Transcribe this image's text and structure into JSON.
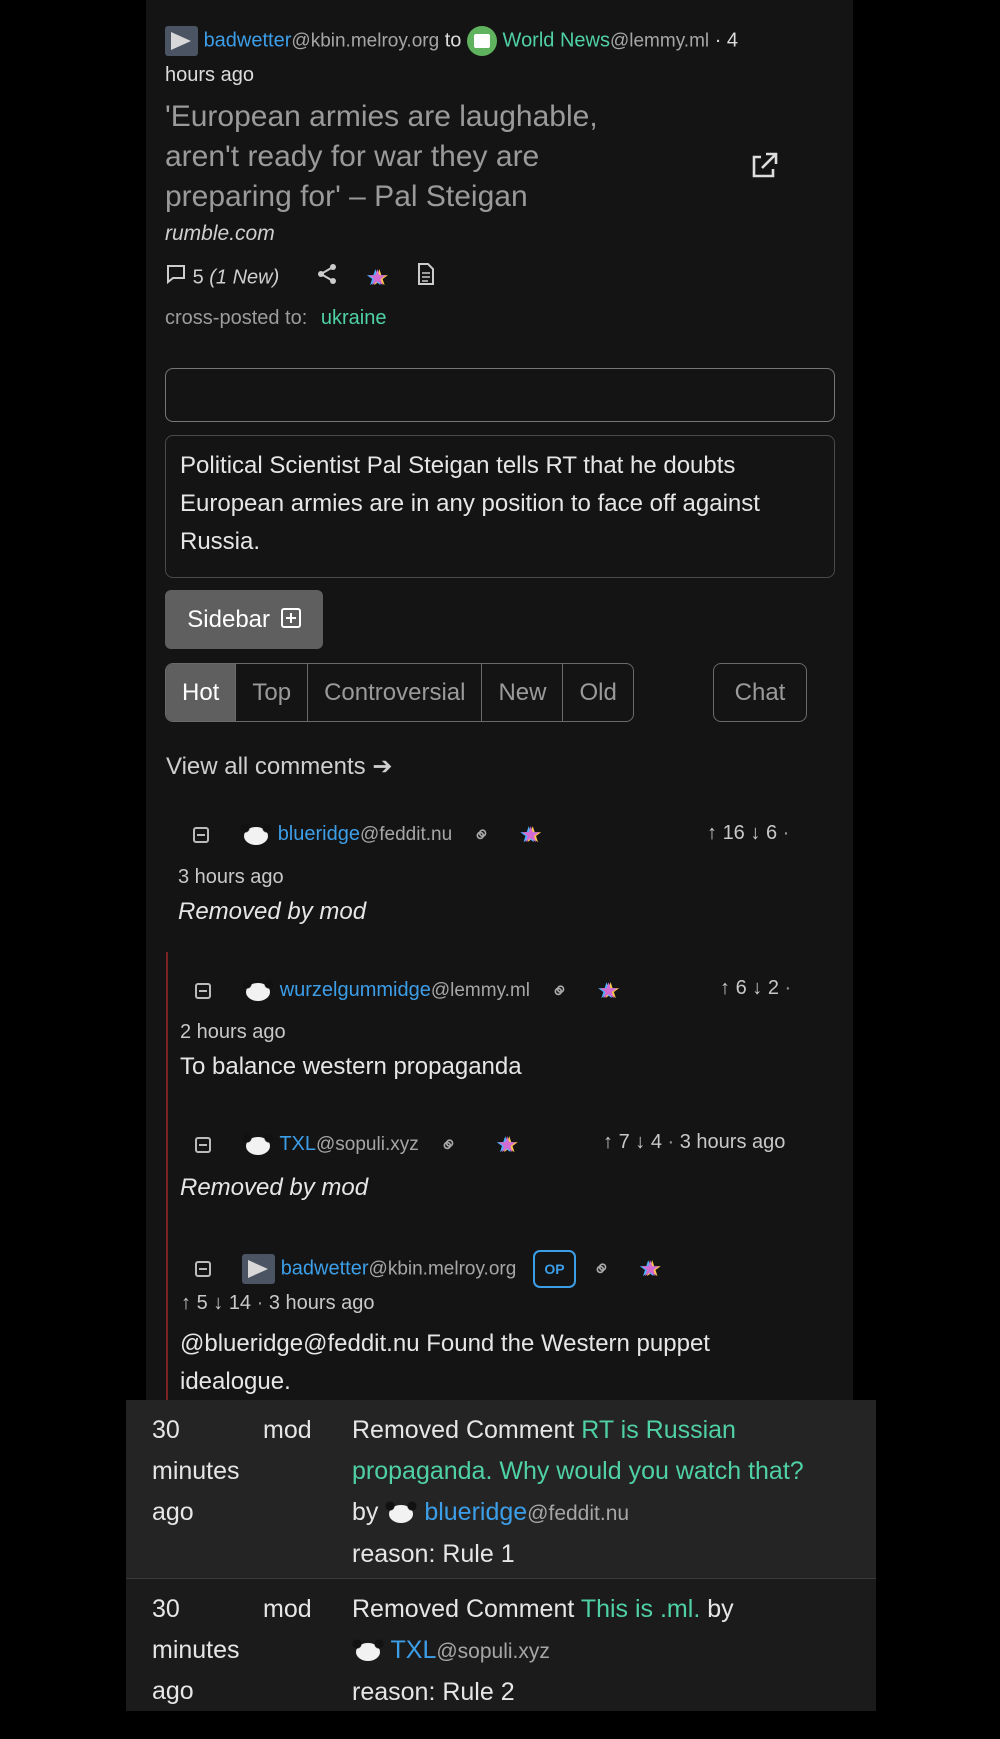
{
  "post": {
    "author_name": "badwetter",
    "author_instance": "@kbin.melroy.org",
    "to_word": "to",
    "community_name": "World News",
    "community_instance": "@lemmy.ml",
    "time_line1": "· 4",
    "time_line2": "hours ago",
    "title_lines": [
      "'European armies are laughable,",
      "aren't ready for war they are",
      "preparing for' – Pal Steigan"
    ],
    "domain": "rumble.com",
    "comment_count": "5",
    "comment_new": "(1 New)",
    "crosspost_label": "cross-posted to:",
    "crosspost_target": "ukraine",
    "body": "Political Scientist Pal Steigan tells RT that he doubts European armies are in any position to face off against Russia.",
    "sidebar_label": "Sidebar"
  },
  "sort_tabs": [
    "Hot",
    "Top",
    "Controversial",
    "New",
    "Old"
  ],
  "chat_label": "Chat",
  "view_all": "View all comments",
  "comments": [
    {
      "name": "blueridge",
      "instance": "@feddit.nu",
      "up": "16",
      "down": "6",
      "time": "3 hours ago",
      "text": "Removed by mod",
      "removed": true
    },
    {
      "name": "wurzelgummidge",
      "instance": "@lemmy.ml",
      "up": "6",
      "down": "2",
      "time": "2 hours ago",
      "text": "To balance western propaganda",
      "removed": false
    },
    {
      "name": "TXL",
      "instance": "@sopuli.xyz",
      "up": "7",
      "down": "4",
      "time": "3 hours ago",
      "text": "Removed by mod",
      "removed": true
    },
    {
      "name": "badwetter",
      "instance": "@kbin.melroy.org",
      "badge": "OP",
      "up": "5",
      "down": "14",
      "time": "3 hours ago",
      "text_lines": [
        "@blueridge@feddit.nu Found the Western puppet",
        "idealogue."
      ],
      "removed": false
    }
  ],
  "modlog": [
    {
      "when_lines": [
        "30",
        "minutes",
        "ago"
      ],
      "who": "mod",
      "action": "Removed Comment",
      "comment_lines": [
        "RT is Russian",
        "propaganda. Why would you watch that?"
      ],
      "by": "by",
      "user": "blueridge",
      "user_instance": "@feddit.nu",
      "reason": "reason: Rule 1"
    },
    {
      "when_lines": [
        "30",
        "minutes",
        "ago"
      ],
      "who": "mod",
      "action": "Removed Comment",
      "comment_lines": [
        "This is .ml."
      ],
      "by": "by",
      "user": "TXL",
      "user_instance": "@sopuli.xyz",
      "reason": "reason: Rule 2"
    }
  ]
}
